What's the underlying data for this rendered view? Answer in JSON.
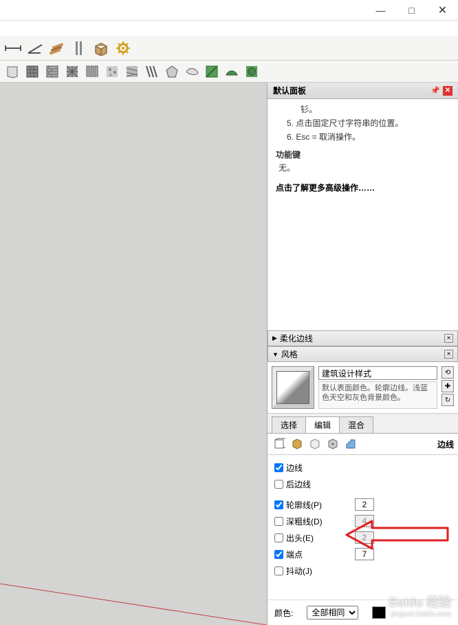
{
  "window": {
    "minimize": "—",
    "maximize": "□",
    "close": "✕"
  },
  "panel": {
    "title": "默认面板",
    "help": {
      "item4_prefix": "钐。",
      "item5": "5. 点击固定尺寸字符串的位置。",
      "item6": "6. Esc = 取消操作。",
      "func_title": "功能键",
      "func_none": "无。",
      "more_link": "点击了解更多高级操作……"
    }
  },
  "sections": {
    "soften": "柔化边线",
    "style": "风格"
  },
  "style": {
    "name": "建筑设计样式",
    "desc": "默认表面颜色。轮廓边线。浅蓝色天空和灰色背景颜色。"
  },
  "tabs": {
    "select": "选择",
    "edit": "编辑",
    "mix": "混合"
  },
  "sub_label": "边线",
  "edges": {
    "edge": "边线",
    "back_edge": "后边线",
    "profile": "轮廓线(P)",
    "profile_val": "2",
    "depth": "深粗线(D)",
    "depth_val": "4",
    "extension": "出头(E)",
    "extension_val": "2",
    "endpoint": "端点",
    "endpoint_val": "7",
    "jitter": "抖动(J)"
  },
  "color": {
    "label": "颜色:",
    "option": "全部相同"
  },
  "watermark": {
    "main": "Baidu 经验",
    "sub": "jingyan.baidu.com"
  }
}
